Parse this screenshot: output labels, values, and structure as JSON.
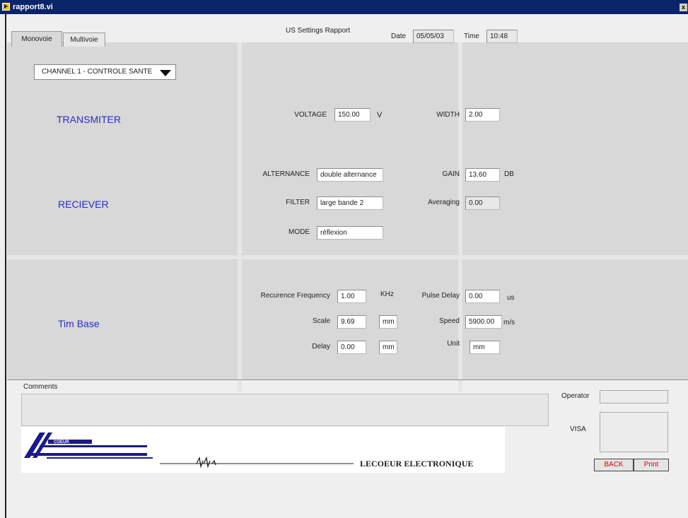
{
  "window": {
    "title": "rapport8.vi",
    "close_glyph": "x"
  },
  "tabs": [
    {
      "label": "Monovoie"
    },
    {
      "label": "Multivoie"
    }
  ],
  "header": {
    "report_title": "US Settings Rapport",
    "date_label": "Date",
    "date_value": "05/05/03",
    "time_label": "Time",
    "time_value": "10:48"
  },
  "channel": {
    "selected": "CHANNEL 1 - CONTROLE SANTE"
  },
  "transmitter": {
    "title": "TRANSMITER",
    "voltage_label": "VOLTAGE",
    "voltage_value": "150.00",
    "voltage_unit": "V",
    "width_label": "WIDTH",
    "width_value": "2.00"
  },
  "receiver": {
    "title": "RECIEVER",
    "alternance_label": "ALTERNANCE",
    "alternance_value": "double alternance",
    "gain_label": "GAIN",
    "gain_value": "13.60",
    "gain_unit": "DB",
    "filter_label": "FILTER",
    "filter_value": "large bande 2",
    "averaging_label": "Averaging",
    "averaging_value": "0.00",
    "mode_label": "MODE",
    "mode_value": "réflexion"
  },
  "timebase": {
    "title": "Tim Base",
    "recurrence_label": "Recurence Frequency",
    "recurrence_value": "1.00",
    "recurrence_unit": "KHz",
    "pulse_delay_label": "Pulse Delay",
    "pulse_delay_value": "0.00",
    "pulse_delay_unit": "us",
    "scale_label": "Scale",
    "scale_value": "9.69",
    "scale_unit": "mm",
    "speed_label": "Speed",
    "speed_value": "5900.00",
    "speed_unit": "m/s",
    "delay_label": "Delay",
    "delay_value": "0.00",
    "delay_unit": "mm",
    "unit_label": "Unit",
    "unit_value": "mm"
  },
  "footer": {
    "comments_label": "Comments",
    "operator_label": "Operator",
    "visa_label": "VISA",
    "back_label": "BACK",
    "print_label": "Print",
    "logo_text": "COEUR",
    "company_name": "LECOEUR ELECTRONIQUE"
  },
  "colors": {
    "section_title": "#2a2ad0",
    "button_text": "#e00000",
    "titlebar": "#0a246a"
  }
}
